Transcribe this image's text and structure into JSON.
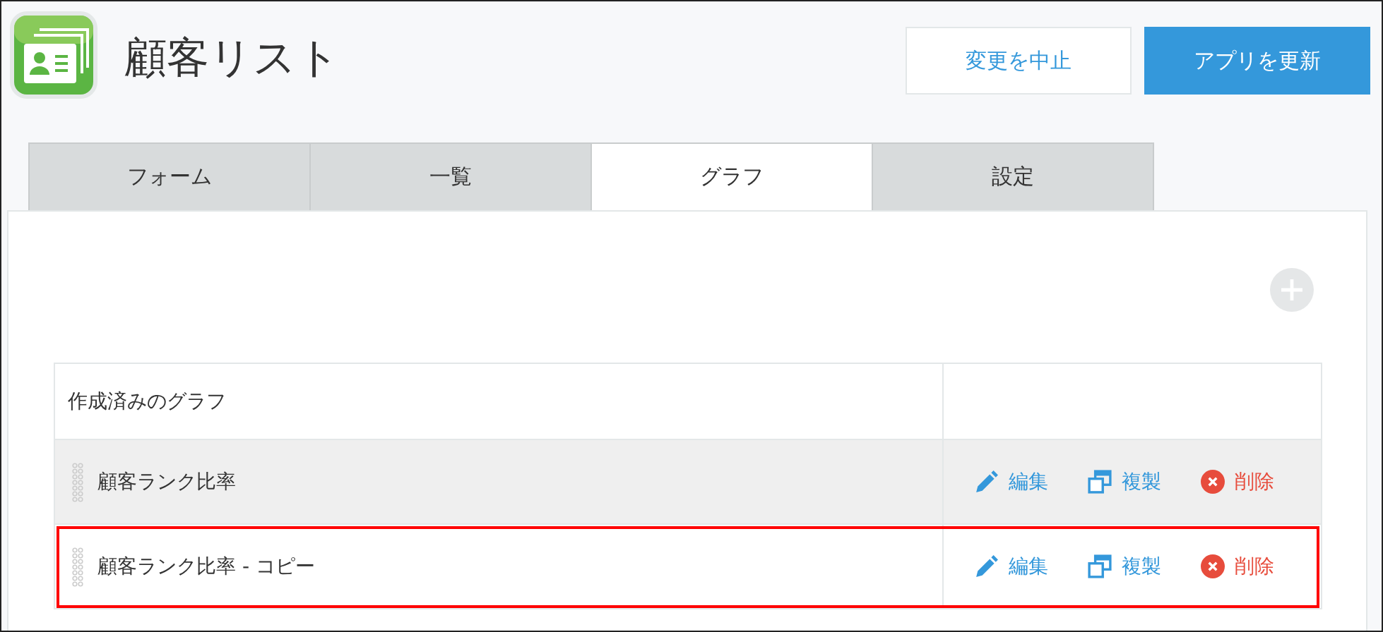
{
  "app": {
    "title": "顧客リスト"
  },
  "buttons": [
    {
      "label": "変更を中止",
      "kind": "secondary"
    },
    {
      "label": "アプリを更新",
      "kind": "primary"
    }
  ],
  "tabs": [
    {
      "label": "フォーム",
      "selected": false
    },
    {
      "label": "一覧",
      "selected": false
    },
    {
      "label": "グラフ",
      "selected": true
    },
    {
      "label": "設定",
      "selected": false
    }
  ],
  "table": {
    "header": "作成済みのグラフ",
    "rows": [
      {
        "name": "顧客ランク比率",
        "hovered": true,
        "highlighted": false,
        "actions": [
          {
            "kind": "edit",
            "label": "編集"
          },
          {
            "kind": "copy",
            "label": "複製"
          },
          {
            "kind": "delete",
            "label": "削除"
          }
        ]
      },
      {
        "name": "顧客ランク比率 - コピー",
        "hovered": false,
        "highlighted": true,
        "actions": [
          {
            "kind": "edit",
            "label": "編集"
          },
          {
            "kind": "copy",
            "label": "複製"
          },
          {
            "kind": "delete",
            "label": "削除"
          }
        ]
      }
    ]
  }
}
